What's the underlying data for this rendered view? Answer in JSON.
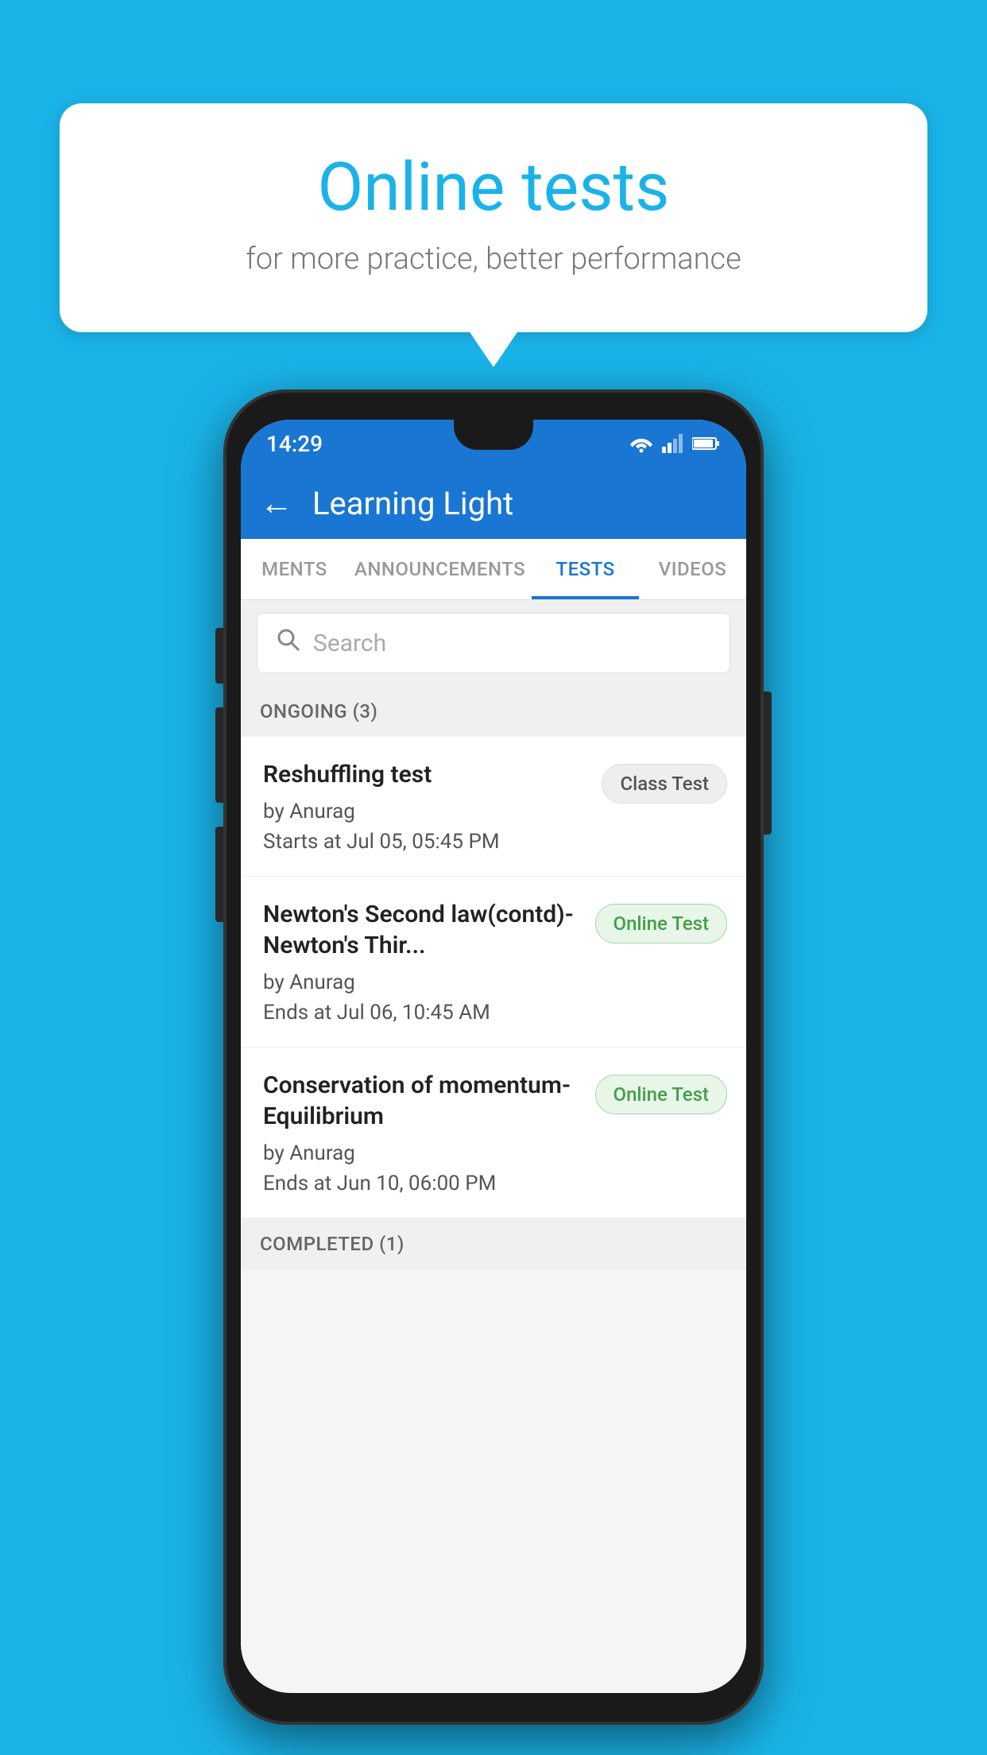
{
  "background_color": "#1ab3e8",
  "speech_bubble": {
    "title": "Online tests",
    "subtitle": "for more practice, better performance"
  },
  "phone": {
    "status_bar": {
      "time": "14:29",
      "wifi": "▼",
      "signal": "▲",
      "battery": "▐"
    },
    "app_bar": {
      "title": "Learning Light",
      "back_label": "←"
    },
    "tabs": [
      {
        "label": "MENTS",
        "active": false
      },
      {
        "label": "ANNOUNCEMENTS",
        "active": false
      },
      {
        "label": "TESTS",
        "active": true
      },
      {
        "label": "VIDEOS",
        "active": false
      }
    ],
    "search": {
      "placeholder": "Search"
    },
    "ongoing_section": {
      "header": "ONGOING (3)",
      "items": [
        {
          "name": "Reshuffling test",
          "author": "by Anurag",
          "date": "Starts at  Jul 05, 05:45 PM",
          "badge": "Class Test",
          "badge_type": "class"
        },
        {
          "name": "Newton's Second law(contd)-Newton's Thir...",
          "author": "by Anurag",
          "date": "Ends at  Jul 06, 10:45 AM",
          "badge": "Online Test",
          "badge_type": "online"
        },
        {
          "name": "Conservation of momentum-Equilibrium",
          "author": "by Anurag",
          "date": "Ends at  Jun 10, 06:00 PM",
          "badge": "Online Test",
          "badge_type": "online"
        }
      ]
    },
    "completed_section": {
      "header": "COMPLETED (1)"
    }
  }
}
